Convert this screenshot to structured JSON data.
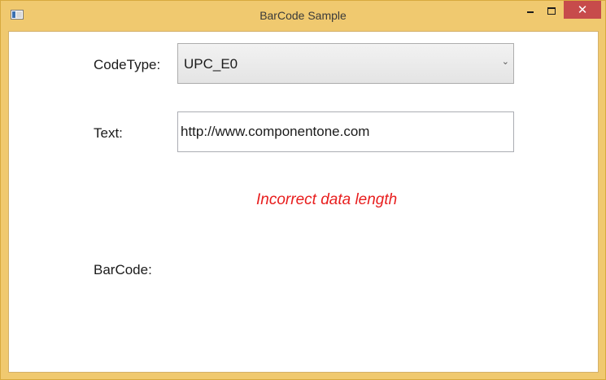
{
  "window": {
    "title": "BarCode Sample",
    "close_glyph": "✕"
  },
  "form": {
    "codetype_label": "CodeType:",
    "codetype_value": "UPC_E0",
    "text_label": "Text:",
    "text_value": "http://www.componentone.com",
    "error_message": "Incorrect data length",
    "barcode_label": "BarCode:"
  },
  "colors": {
    "frame": "#F0C96F",
    "close_button": "#C74B4B",
    "error_text": "#E81E1E"
  },
  "icons": {
    "app": "app-window-icon",
    "dropdown": "chevron-down-icon"
  }
}
